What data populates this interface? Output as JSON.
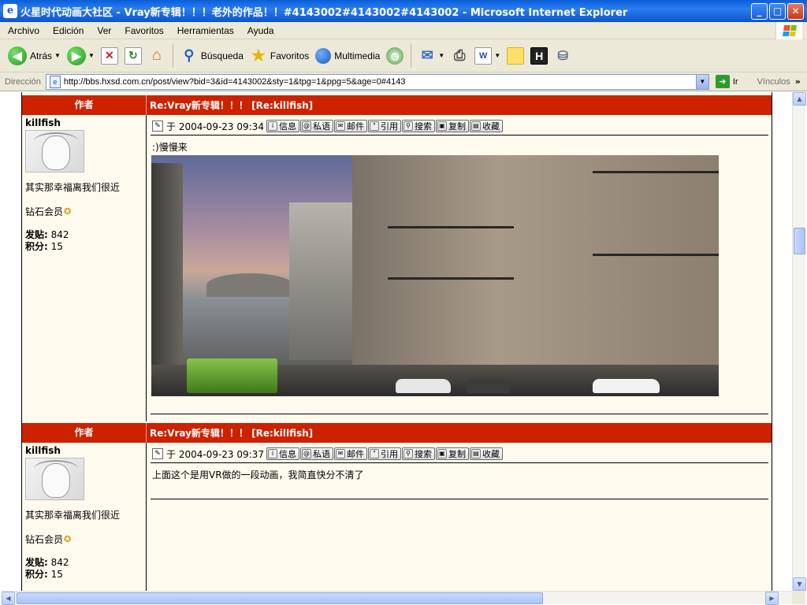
{
  "window": {
    "title": "火星时代动画大社区 - Vray新专辑！！！老外的作品！！#4143002#4143002#4143002 - Microsoft Internet Explorer",
    "app_icon": "e",
    "minimize": "_",
    "maximize": "□",
    "close": "✕"
  },
  "menu": {
    "items": [
      "Archivo",
      "Edición",
      "Ver",
      "Favoritos",
      "Herramientas",
      "Ayuda"
    ]
  },
  "toolbar": {
    "back_label": "Atrás",
    "search_label": "Búsqueda",
    "favorites_label": "Favoritos",
    "multimedia_label": "Multimedia"
  },
  "address": {
    "label": "Dirección",
    "url": "http://bbs.hxsd.com.cn/post/view?bid=3&id=4143002&sty=1&tpg=1&ppg=5&age=0#4143",
    "go_label": "Ir",
    "links_label": "Vínculos"
  },
  "posts": [
    {
      "header_author": "作者",
      "header_subject": "Re:Vray新专辑！！！ [Re:killfish]",
      "username": "killfish",
      "signature": "其实那幸福离我们很近",
      "rank": "钻石会员",
      "posts_label": "发贴:",
      "posts_value": "842",
      "points_label": "积分:",
      "points_value": "15",
      "date": "于 2004-09-23 09:34",
      "body": ":)慢慢来"
    },
    {
      "header_author": "作者",
      "header_subject": "Re:Vray新专辑！！！ [Re:killfish]",
      "username": "killfish",
      "signature": "其实那幸福离我们很近",
      "rank": "钻石会员",
      "posts_label": "发贴:",
      "posts_value": "842",
      "points_label": "积分:",
      "points_value": "15",
      "date": "于 2004-09-23 09:37",
      "body": "上面这个是用VR做的一段动画，我简直快分不清了"
    }
  ],
  "post_actions": [
    "信息",
    "私语",
    "邮件",
    "引用",
    "搜索",
    "复制",
    "收藏"
  ],
  "colors": {
    "header_red": "#cc2200",
    "content_bg": "#fffaee",
    "titlebar_blue": "#0a5fd8"
  }
}
